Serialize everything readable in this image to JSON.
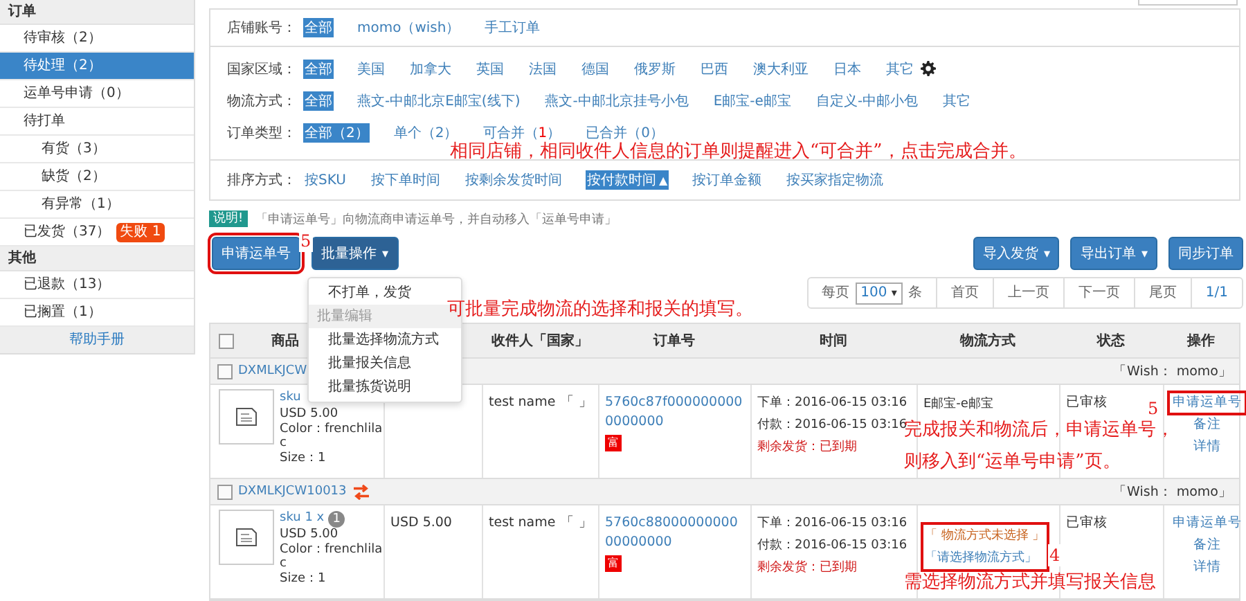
{
  "sidebar": {
    "sections": [
      {
        "title": "订单",
        "items": [
          {
            "label": "待审核（2）",
            "selected": false
          },
          {
            "label": "待处理（2）",
            "selected": true
          },
          {
            "label": "运单号申请（0）",
            "selected": false
          },
          {
            "label": "待打单",
            "selected": false,
            "children": [
              {
                "label": "有货（3）",
                "selected": false
              },
              {
                "label": "缺货（2）",
                "selected": false
              },
              {
                "label": "有异常（1）",
                "selected": false
              }
            ]
          },
          {
            "label": "已发货（37）",
            "selected": false,
            "badge": "失败 1"
          }
        ]
      },
      {
        "title": "其他",
        "items": [
          {
            "label": "已退款（13）",
            "selected": false
          },
          {
            "label": "已搁置（1）",
            "selected": false
          }
        ]
      }
    ],
    "help": "帮助手册"
  },
  "filters": [
    {
      "label": "店铺账号：",
      "settings": false,
      "options": [
        {
          "label": "全部",
          "selected": true
        },
        {
          "label": "momo（wish）",
          "selected": false
        },
        {
          "label": "手工订单",
          "selected": false
        }
      ]
    },
    {
      "label": "国家区域：",
      "settings": true,
      "options": [
        {
          "label": "全部",
          "selected": true
        },
        {
          "label": "美国",
          "selected": false
        },
        {
          "label": "加拿大",
          "selected": false
        },
        {
          "label": "英国",
          "selected": false
        },
        {
          "label": "法国",
          "selected": false
        },
        {
          "label": "德国",
          "selected": false
        },
        {
          "label": "俄罗斯",
          "selected": false
        },
        {
          "label": "巴西",
          "selected": false
        },
        {
          "label": "澳大利亚",
          "selected": false
        },
        {
          "label": "日本",
          "selected": false
        },
        {
          "label": "其它",
          "selected": false
        }
      ]
    },
    {
      "label": "物流方式：",
      "settings": false,
      "options": [
        {
          "label": "全部",
          "selected": true
        },
        {
          "label": "燕文-中邮北京E邮宝(线下)",
          "selected": false
        },
        {
          "label": "燕文-中邮北京挂号小包",
          "selected": false
        },
        {
          "label": "E邮宝-e邮宝",
          "selected": false
        },
        {
          "label": "自定义-中邮小包",
          "selected": false
        },
        {
          "label": "其它",
          "selected": false
        }
      ]
    },
    {
      "label": "订单类型：",
      "settings": false,
      "options": [
        {
          "label": "全部（2）",
          "selected": true
        },
        {
          "label": "单个（2）",
          "selected": false
        },
        {
          "label": "可合并（",
          "count": "1",
          "tail": "）",
          "selected": false
        },
        {
          "label": "已合并（0）",
          "selected": false
        }
      ]
    }
  ],
  "sort": {
    "label": "排序方式：",
    "options": [
      {
        "label": "按SKU",
        "selected": false
      },
      {
        "label": "按下单时间",
        "selected": false
      },
      {
        "label": "按剩余发货时间",
        "selected": false
      },
      {
        "label": "按付款时间",
        "arrow": "▲",
        "selected": true
      },
      {
        "label": "按订单金额",
        "selected": false
      },
      {
        "label": "按买家指定物流",
        "selected": false
      }
    ]
  },
  "notice": {
    "badge": "说明!",
    "text": "「申请运单号」向物流商申请运单号，并自动移入「运单号申请」"
  },
  "left_buttons": [
    {
      "label": "申请运单号",
      "highlighted": true
    },
    {
      "label": "批量操作",
      "caret": "▾",
      "highlighted": false
    }
  ],
  "right_buttons": [
    {
      "label": "导入发货",
      "caret": "▾"
    },
    {
      "label": "导出订单",
      "caret": "▾"
    },
    {
      "label": "同步订单"
    }
  ],
  "pagination": {
    "per_page": "每页",
    "size": "100",
    "size_caret": "▾",
    "unit": "条",
    "pages": [
      "首页",
      "上一页",
      "下一页",
      "尾页"
    ],
    "current": "1/1"
  },
  "menu": [
    {
      "kind": "item",
      "label": "不打单，发货"
    },
    {
      "kind": "header",
      "label": "批量编辑"
    },
    {
      "kind": "item",
      "label": "批量选择物流方式"
    },
    {
      "kind": "item",
      "label": "批量报关信息"
    },
    {
      "kind": "item",
      "label": "批量拣货说明"
    }
  ],
  "table": {
    "all_checked": false,
    "columns": [
      "商品",
      "收件人「国家」",
      "订单号",
      "时间",
      "物流方式",
      "状态",
      "操作"
    ],
    "orders": [
      {
        "id": "DXMLKJCW",
        "checked": false,
        "merge": false,
        "store": "「Wish： momo」",
        "sku": "sku",
        "unit_price": "USD 5.00",
        "color_option": "Color：frenchlilac",
        "size": "Size：1",
        "recipient": "test name",
        "country": "「 」",
        "order_no": "5760c87f0000000000000000",
        "flag": "富",
        "ordered": "下单：2016-06-15 03:16",
        "paid": "付款：2016-06-15 03:16",
        "remaining": "剩余发货：已到期",
        "logistics": [
          {
            "kind": "plain",
            "label": "E邮宝-e邮宝"
          }
        ],
        "logistics_highlighted": false,
        "status": "已审核",
        "actions": [
          {
            "label": "申请运单号",
            "highlighted": true
          },
          {
            "label": "备注",
            "highlighted": false
          },
          {
            "label": "详情",
            "highlighted": false
          }
        ]
      },
      {
        "id": "DXMLKJCW10013",
        "checked": false,
        "merge": true,
        "store": "「Wish： momo」",
        "sku": "sku 1 x",
        "qty": "1",
        "unit_price": "USD 5.00",
        "color_option": "Color：frenchlilac",
        "size": "Size：1",
        "price": "USD 5.00",
        "recipient": "test name",
        "country": "「 」",
        "order_no": "5760c8800000000000000000",
        "flag": "富",
        "ordered": "下单：2016-06-15 03:16",
        "paid": "付款：2016-06-15 03:16",
        "remaining": "剩余发货：已到期",
        "logistics": [
          {
            "kind": "warning",
            "label": "「 物流方式未选择 」"
          },
          {
            "kind": "link",
            "label": "「请选择物流方式」"
          }
        ],
        "logistics_highlighted": true,
        "status": "已审核",
        "actions": [
          {
            "label": "申请运单号",
            "highlighted": false
          },
          {
            "label": "备注",
            "highlighted": false
          },
          {
            "label": "详情",
            "highlighted": false
          }
        ]
      }
    ]
  },
  "annotations": [
    "相同店铺，相同收件人信息的订单则提醒进入“可合并”，点击完成合并。",
    "5",
    "可批量完成物流的选择和报关的填写。",
    "完成报关和物流后，申请运单号，",
    "则移入到“运单号申请”页。",
    "5",
    "4",
    "需选择物流方式并填写报关信息"
  ]
}
